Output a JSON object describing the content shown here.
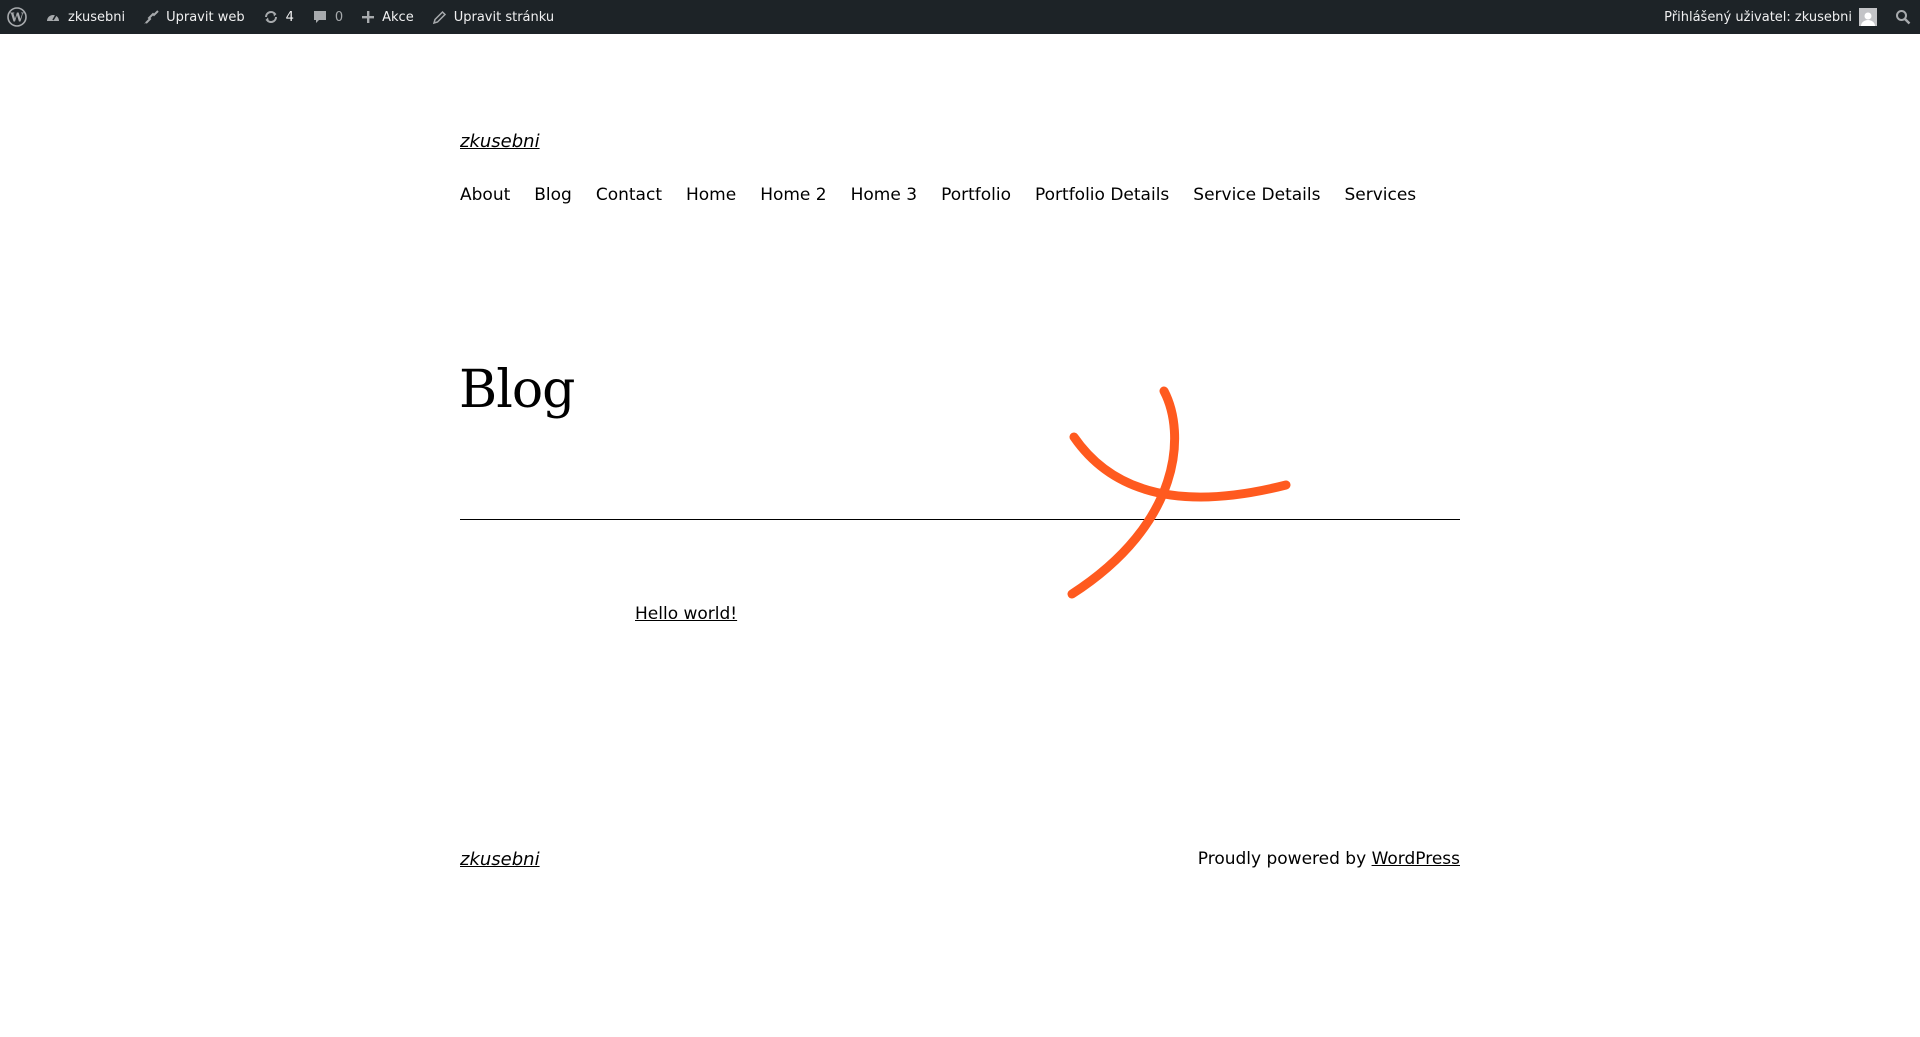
{
  "adminbar": {
    "wp_logo_icon": "wordpress-logo-icon",
    "site_name": "zkusebni",
    "customize_label": "Upravit web",
    "updates_count": "4",
    "comments_count": "0",
    "new_label": "Akce",
    "edit_page_label": "Upravit stránku",
    "account_label": "Přihlášený uživatel: zkusebni",
    "search_icon": "search-icon"
  },
  "header": {
    "site_title": "zkusebni",
    "nav": [
      "About",
      "Blog",
      "Contact",
      "Home",
      "Home 2",
      "Home 3",
      "Portfolio",
      "Portfolio Details",
      "Service Details",
      "Services"
    ]
  },
  "main": {
    "page_title": "Blog",
    "posts": [
      {
        "title": "Hello world!"
      }
    ],
    "accent_color": "#ff5a1f"
  },
  "footer": {
    "site_title": "zkusebni",
    "credit_prefix": "Proudly powered by ",
    "credit_link": "WordPress"
  }
}
